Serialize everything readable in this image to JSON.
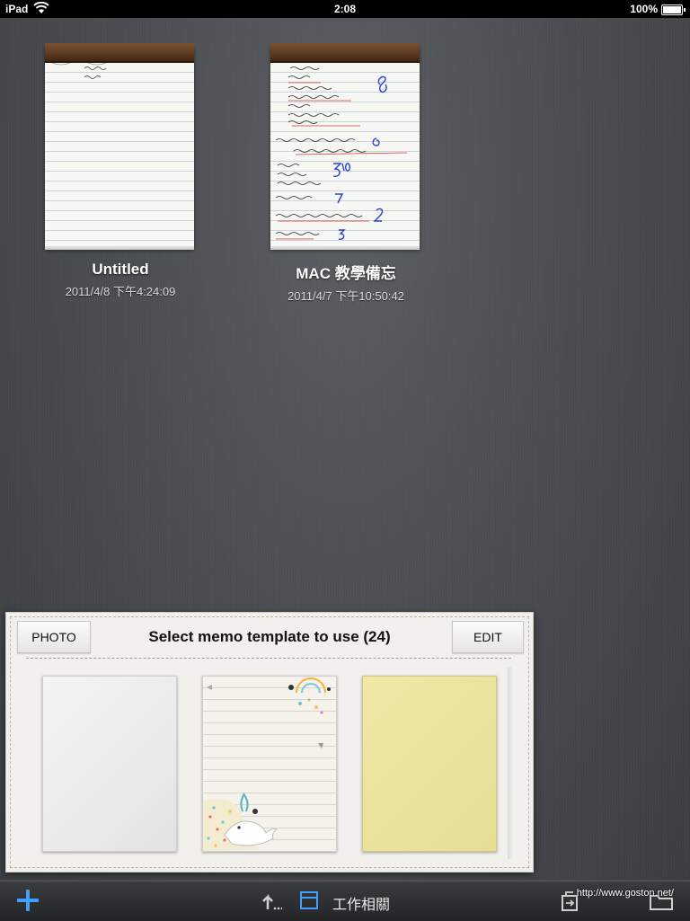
{
  "status_bar": {
    "carrier": "iPad",
    "time": "2:08",
    "battery": "100%",
    "battery_level": 1.0
  },
  "notes": [
    {
      "title": "Untitled",
      "date": "2011/4/8 下午4:24:09"
    },
    {
      "title": "MAC 教學備忘",
      "date": "2011/4/7 下午10:50:42"
    }
  ],
  "template_picker": {
    "photo_label": "PHOTO",
    "title": "Select memo template to use (24)",
    "edit_label": "EDIT",
    "templates": [
      "plain",
      "lined-whale",
      "yellow"
    ]
  },
  "toolbar": {
    "add_icon": "plus-icon",
    "up_icon": "up-arrow-icon",
    "layout_icon": "layout-icon",
    "folder_name": "工作相關",
    "share_icon": "share-icon",
    "folder_icon": "folder-icon",
    "watermark": "http://www.goston.net/"
  },
  "colors": {
    "accent": "#3ea0ff",
    "background": "#4a4e52"
  }
}
